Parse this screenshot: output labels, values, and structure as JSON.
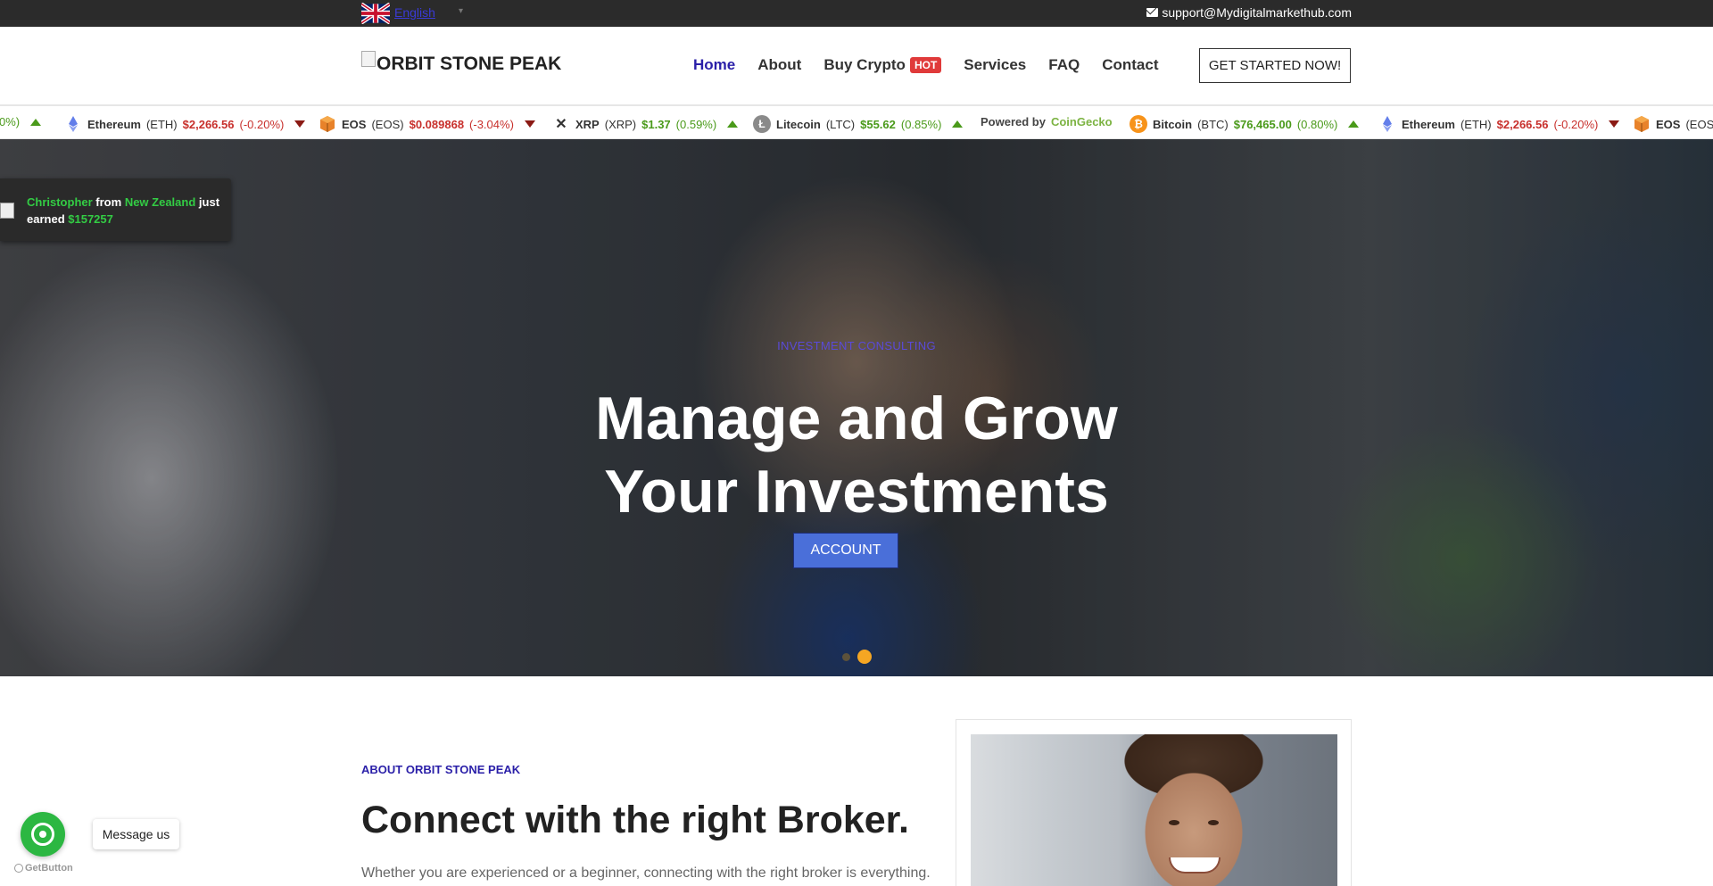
{
  "topbar": {
    "language": "English",
    "email": "support@Mydigitalmarkethub.com"
  },
  "header": {
    "logo": "ORBIT STONE PEAK",
    "nav": [
      {
        "label": "Home",
        "active": true
      },
      {
        "label": "About"
      },
      {
        "label": "Buy Crypto",
        "badge": "HOT"
      },
      {
        "label": "Services"
      },
      {
        "label": "FAQ"
      },
      {
        "label": "Contact"
      }
    ],
    "cta": "GET STARTED NOW!"
  },
  "ticker": {
    "items": [
      {
        "change": "0%)",
        "trend": "up",
        "partial": true
      },
      {
        "icon": "ethereum-icon",
        "name": "Ethereum",
        "symbol": "(ETH)",
        "price": "$2,266.56",
        "change": "(-0.20%)",
        "trend": "down"
      },
      {
        "icon": "eos-icon",
        "name": "EOS",
        "symbol": "(EOS)",
        "price": "$0.089868",
        "change": "(-3.04%)",
        "trend": "down"
      },
      {
        "icon": "xrp-icon",
        "name": "XRP",
        "symbol": "(XRP)",
        "price": "$1.37",
        "change": "(0.59%)",
        "trend": "up"
      },
      {
        "icon": "litecoin-icon",
        "name": "Litecoin",
        "symbol": "(LTC)",
        "price": "$55.62",
        "change": "(0.85%)",
        "trend": "up"
      },
      {
        "powered_prefix": "Powered by",
        "powered_brand": "CoinGecko"
      },
      {
        "icon": "bitcoin-icon",
        "name": "Bitcoin",
        "symbol": "(BTC)",
        "price": "$76,465.00",
        "change": "(0.80%)",
        "trend": "up"
      },
      {
        "icon": "ethereum-icon",
        "name": "Ethereum",
        "symbol": "(ETH)",
        "price": "$2,266.56",
        "change": "(-0.20%)",
        "trend": "down"
      },
      {
        "icon": "eos-icon",
        "name": "EOS",
        "symbol": "(EOS",
        "partial": true
      }
    ]
  },
  "notification": {
    "name": "Christopher",
    "from": "from",
    "country": "New Zealand",
    "just": "just",
    "earned": "earned",
    "amount": "$157257"
  },
  "hero": {
    "subtitle": "INVESTMENT CONSULTING",
    "title_line1": "Manage and Grow",
    "title_line2": "Your Investments",
    "button": "ACCOUNT",
    "slide_count": 2,
    "active_slide": 2
  },
  "about": {
    "tag": "ABOUT ORBIT STONE PEAK",
    "heading": "Connect with the right Broker.",
    "paragraph": "Whether you are experienced or a beginner, connecting with the right broker is everything."
  },
  "whatsapp": {
    "message": "Message us",
    "brand": "GetButton"
  },
  "colors": {
    "accent": "#2a1fa8",
    "hero_button": "#4a6fd9",
    "up": "#4a9a1a",
    "down": "#c8302c",
    "whatsapp": "#2cb742",
    "hot_badge": "#e03a3a"
  }
}
